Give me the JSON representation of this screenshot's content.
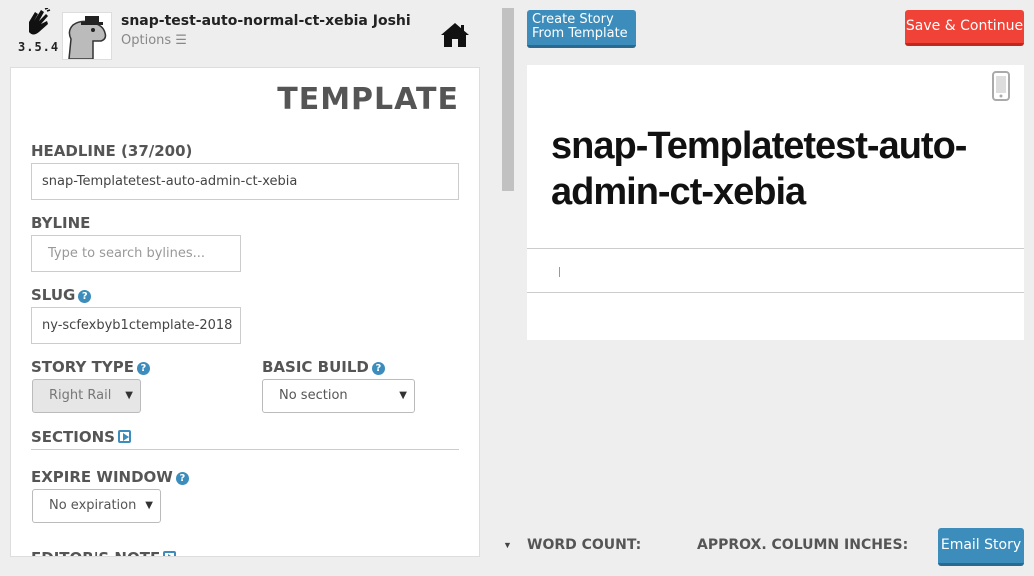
{
  "app": {
    "version": "3.5.4",
    "user_title": "snap-test-auto-normal-ct-xebia Joshi",
    "options_label": "Options ☰"
  },
  "form": {
    "title": "TEMPLATE",
    "headline_label": "HEADLINE (37/200)",
    "headline_value": "snap-Templatetest-auto-admin-ct-xebia",
    "byline_label": "BYLINE",
    "byline_placeholder": "Type to search bylines...",
    "slug_label": "SLUG",
    "slug_value": "ny-scfexbyb1ctemplate-2018",
    "story_type_label": "STORY TYPE",
    "story_type_value": "Right Rail",
    "basic_build_label": "BASIC BUILD",
    "basic_build_value": "No section",
    "sections_label": "SECTIONS",
    "expire_window_label": "EXPIRE WINDOW",
    "expire_window_value": "No expiration",
    "editors_note_label": "EDITOR'S NOTE"
  },
  "actions": {
    "create_from_template": "Create Story From Template",
    "save_continue": "Save & Continue",
    "email_story": "Email Story"
  },
  "preview": {
    "headline": "snap-Templatetest-auto-admin-ct-xebia"
  },
  "footer": {
    "word_count_label": "WORD COUNT:",
    "column_inches_label": "APPROX. COLUMN INCHES:"
  },
  "colors": {
    "accent": "#3c8dbc",
    "danger": "#f04236"
  }
}
